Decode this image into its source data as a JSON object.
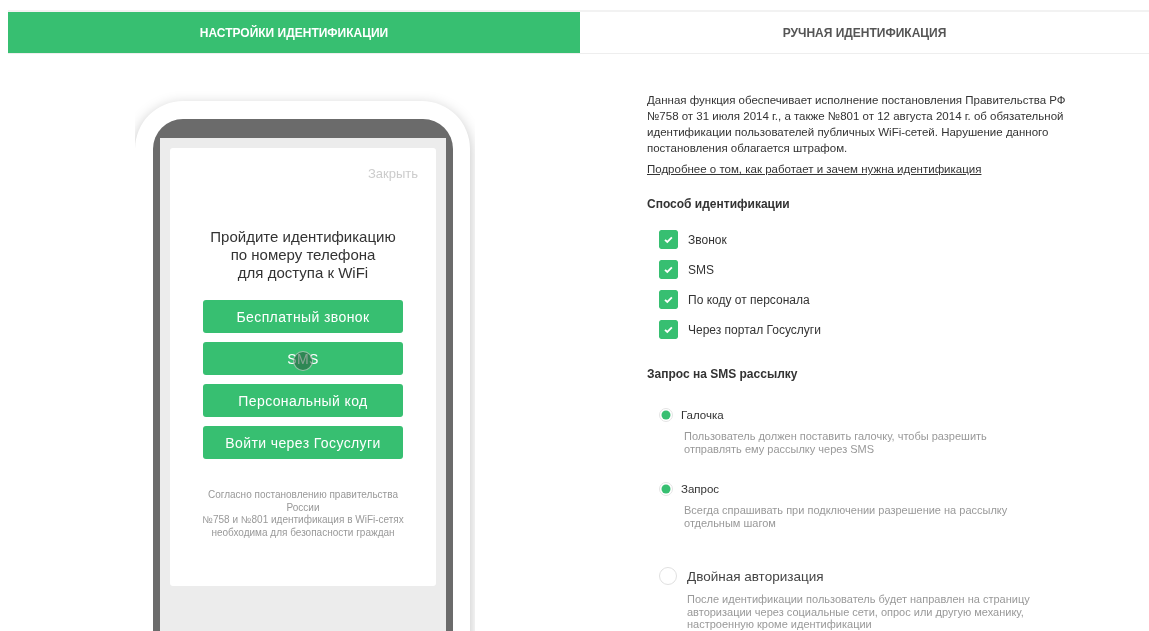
{
  "tabs": [
    {
      "label": "НАСТРОЙКИ ИДЕНТИФИКАЦИИ",
      "selected": true
    },
    {
      "label": "РУЧНАЯ ИДЕНТИФИКАЦИЯ",
      "selected": false
    }
  ],
  "phone_preview": {
    "close": "Закрыть",
    "title": "Пройдите идентификацию\nпо номеру телефона\nдля доступа к WiFi",
    "buttons": [
      {
        "label": "Бесплатный звонок",
        "touched": false
      },
      {
        "label": "SMS",
        "touched": true
      },
      {
        "label": "Персональный код",
        "touched": false
      },
      {
        "label": "Войти через Госуслуги",
        "touched": false
      }
    ],
    "footnote": "Согласно постановлению правительства\nРоссии\n№758 и №801 идентификация в WiFi-сетях\nнеобходима для безопасности граждан"
  },
  "settings": {
    "intro": "Данная функция обеспечивает исполнение постановления Правительства РФ\n№758 от 31 июля 2014 г., а также №801 от 12 августа 2014 г. об обязательной\nидентификации пользователей публичных WiFi-сетей. Нарушение данного\nпостановления облагается штрафом.",
    "link": "Подробнее о том, как работает и зачем нужна идентификация",
    "method_heading": "Способ идентификации",
    "methods": [
      {
        "label": "Звонок",
        "checked": true
      },
      {
        "label": "SMS",
        "checked": true
      },
      {
        "label": "По коду от персонала",
        "checked": true
      },
      {
        "label": "Через портал Госуслуги",
        "checked": true
      }
    ],
    "sms_heading": "Запрос на SMS рассылку",
    "sms_options": [
      {
        "label": "Галочка",
        "description": "Пользователь должен поставить галочку, чтобы разрешить\nотправлять ему рассылку через SMS",
        "selected": true
      },
      {
        "label": "Запрос",
        "description": "Всегда спрашивать при подключении разрешение на рассылку\nотдельным шагом",
        "selected": true
      }
    ],
    "double_auth": {
      "label": "Двойная авторизация",
      "checked": false,
      "description": "После идентификации пользователь будет направлен на страницу\nавторизации через социальные сети, опрос или другую механику,\nнастроенную кроме идентификации"
    }
  }
}
